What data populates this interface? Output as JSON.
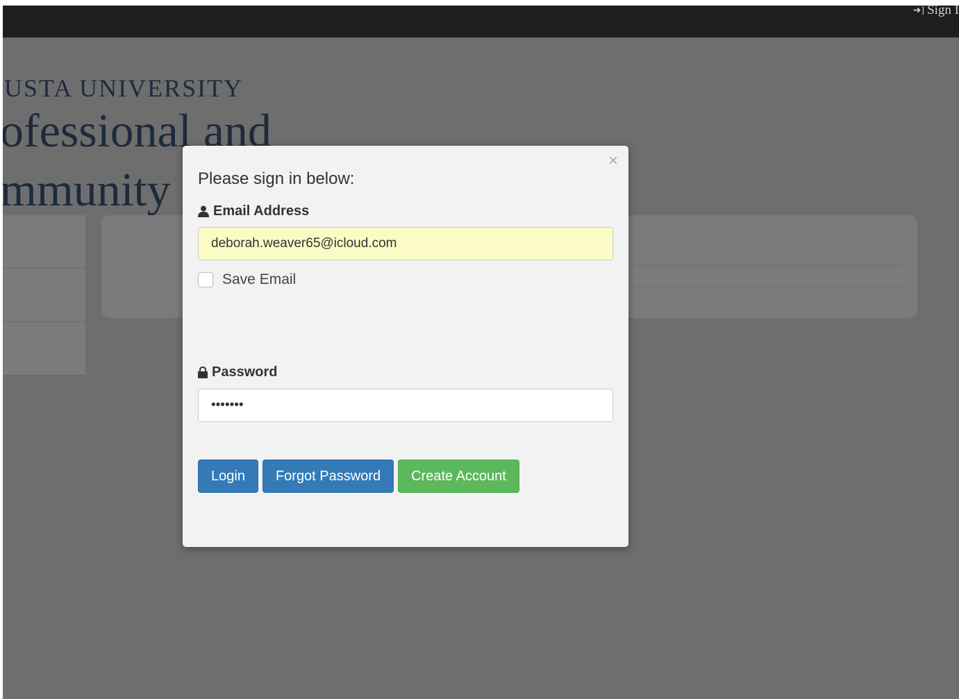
{
  "navbar": {
    "signin_label": "Sign I",
    "signin_icon": "sign-in-icon"
  },
  "branding": {
    "line1": "USTA UNIVERSITY",
    "line2": "ofessional and",
    "line3": "mmunity"
  },
  "modal": {
    "title": "Please sign in below:",
    "close_icon": "close-icon",
    "email": {
      "label": "Email Address",
      "icon": "user-icon",
      "value": "deborah.weaver65@icloud.com"
    },
    "save_email": {
      "label": "Save Email",
      "checked": false
    },
    "password": {
      "label": "Password",
      "icon": "lock-icon",
      "value": "•••••••"
    },
    "buttons": {
      "login": "Login",
      "forgot": "Forgot Password",
      "create": "Create Account"
    }
  },
  "colors": {
    "primary": "#337ab7",
    "success": "#5cb85c",
    "autofill": "#fbfbc5",
    "navbar": "#1e1e1e"
  }
}
